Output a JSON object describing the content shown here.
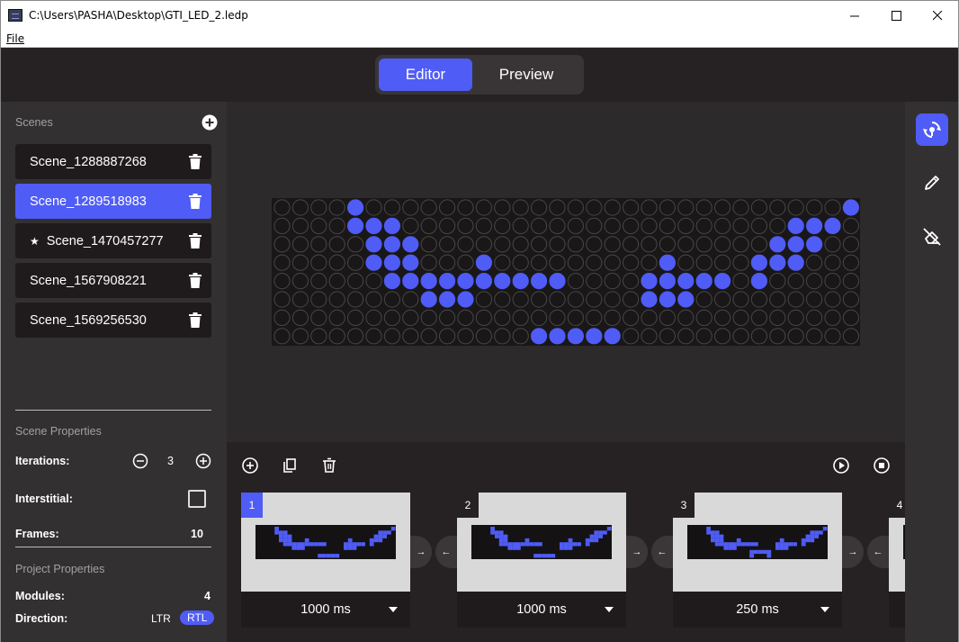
{
  "window": {
    "title": "C:\\Users\\PASHA\\Desktop\\GTI_LED_2.ledp",
    "minimize": "—",
    "maximize": "☐",
    "close": "✕"
  },
  "menu": {
    "file": "File"
  },
  "mode_toggle": {
    "editor": "Editor",
    "preview": "Preview",
    "active": "Editor"
  },
  "scenes": {
    "title": "Scenes",
    "items": [
      {
        "name": "Scene_1288887268",
        "active": false,
        "starred": false
      },
      {
        "name": "Scene_1289518983",
        "active": true,
        "starred": false
      },
      {
        "name": "Scene_1470457277",
        "active": false,
        "starred": true
      },
      {
        "name": "Scene_1567908221",
        "active": false,
        "starred": false
      },
      {
        "name": "Scene_1569256530",
        "active": false,
        "starred": false
      }
    ]
  },
  "scene_properties": {
    "title": "Scene Properties",
    "iterations_label": "Iterations:",
    "iterations_value": "3",
    "interstitial_label": "Interstitial:",
    "interstitial_checked": false,
    "frames_label": "Frames:",
    "frames_value": "10"
  },
  "project_properties": {
    "title": "Project Properties",
    "modules_label": "Modules:",
    "modules_value": "4",
    "direction_label": "Direction:",
    "direction_ltr": "LTR",
    "direction_rtl": "RTL",
    "direction_active": "RTL"
  },
  "led_matrix": {
    "columns": 32,
    "rows": 8,
    "on_color": "#4f5cf6",
    "off_color": "#1a1718",
    "rows_on": [
      "....#..........................#",
      "....###.....................###.",
      ".....###...................###..",
      ".....###...#.........#....###...",
      "......##########....#####.#.....",
      "........###.........###.........",
      "................................",
      "..............#####............."
    ]
  },
  "frames": [
    {
      "number": "1",
      "duration": "1000 ms",
      "active": true,
      "rows_on": [
        "....#..........................#",
        "....###.....................###.",
        ".....###...................###..",
        ".....###...#.........#....###...",
        "......##########....#####.#.....",
        "........###.........###.........",
        "................................",
        "..............#####............."
      ]
    },
    {
      "number": "2",
      "duration": "1000 ms",
      "active": false,
      "rows_on": [
        "....#..........................#",
        "....###.....................###.",
        ".....###...................###..",
        "......##....#.........#...###...",
        "......##########....#####.#.....",
        "........###.........###.........",
        "................................",
        "..............#####............."
      ]
    },
    {
      "number": "3",
      "duration": "250 ms",
      "active": false,
      "rows_on": [
        "....#..........................#",
        "....###.....................###.",
        ".....###...................###..",
        ".....###...#.........#....###...",
        "......##########....#####.#.....",
        "........###.........###.........",
        "..............#####.............",
        "..............#...#............."
      ]
    },
    {
      "number": "4",
      "duration": "",
      "active": false,
      "rows_on": []
    }
  ],
  "frame_nav": {
    "next": "→",
    "prev": "←"
  },
  "colors": {
    "accent": "#4f5cf6",
    "panel": "#333031",
    "dark": "#262223"
  }
}
